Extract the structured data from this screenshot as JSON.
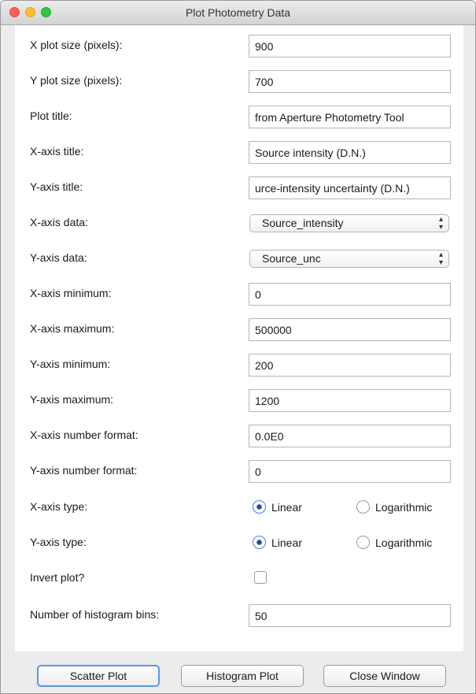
{
  "window": {
    "title": "Plot Photometry Data"
  },
  "fields": [
    {
      "label": "X plot size (pixels):",
      "value": "900"
    },
    {
      "label": "Y plot size (pixels):",
      "value": "700"
    },
    {
      "label": "Plot title:",
      "value": "from Aperture Photometry Tool"
    },
    {
      "label": "X-axis title:",
      "value": "Source intensity (D.N.)"
    },
    {
      "label": "Y-axis title:",
      "value": "urce-intensity uncertainty (D.N.)"
    }
  ],
  "selects": [
    {
      "label": "X-axis data:",
      "value": "Source_intensity"
    },
    {
      "label": "Y-axis data:",
      "value": "Source_unc"
    }
  ],
  "fields2": [
    {
      "label": "X-axis minimum:",
      "value": "0"
    },
    {
      "label": "X-axis maximum:",
      "value": "500000"
    },
    {
      "label": "Y-axis minimum:",
      "value": "200"
    },
    {
      "label": "Y-axis maximum:",
      "value": "1200"
    },
    {
      "label": "X-axis number format:",
      "value": "0.0E0"
    },
    {
      "label": "Y-axis number format:",
      "value": "0"
    }
  ],
  "axis_types": [
    {
      "label": "X-axis type:",
      "option1": "Linear",
      "option2": "Logarithmic",
      "selected": "Linear"
    },
    {
      "label": "Y-axis type:",
      "option1": "Linear",
      "option2": "Logarithmic",
      "selected": "Linear"
    }
  ],
  "invert": {
    "label": "Invert plot?",
    "checked": false
  },
  "bins": {
    "label": "Number of histogram bins:",
    "value": "50"
  },
  "buttons": {
    "scatter": "Scatter Plot",
    "histogram": "Histogram Plot",
    "close": "Close Window"
  }
}
